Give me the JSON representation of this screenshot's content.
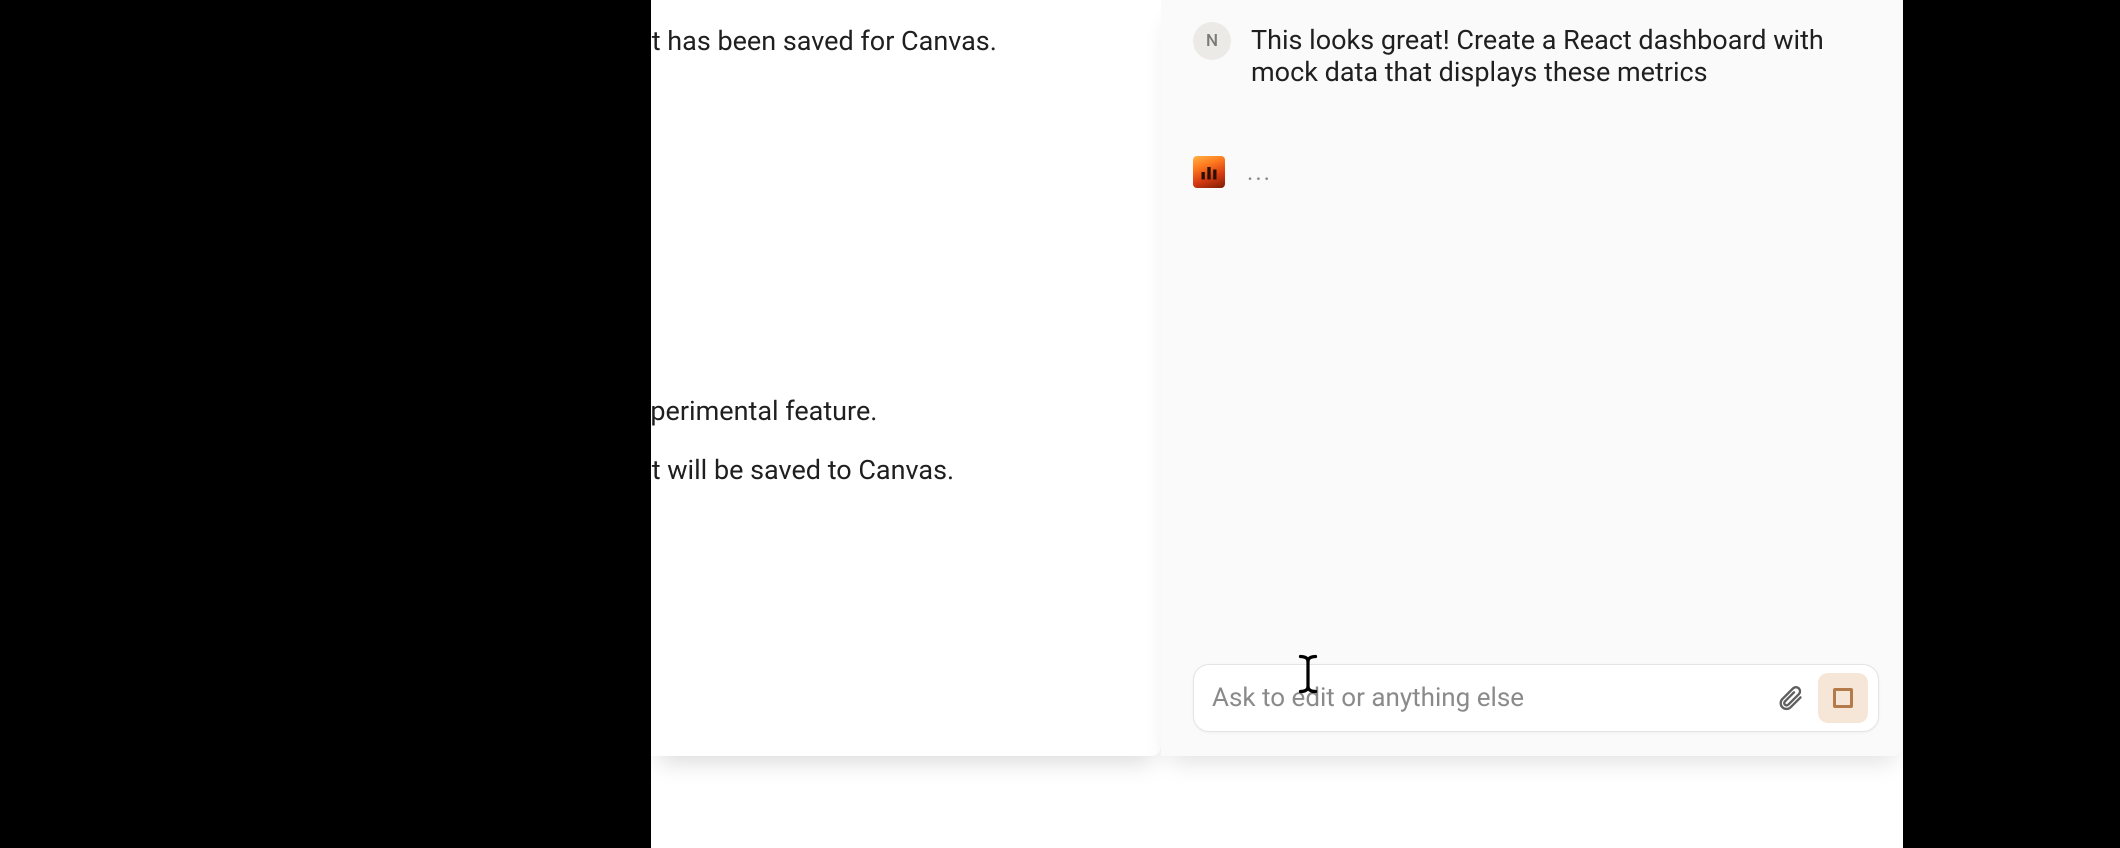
{
  "left_panel": {
    "line1": "This document has been saved for Canvas.",
    "line2": "This is an experimental feature.",
    "line3": "This document will be saved to Canvas."
  },
  "chat": {
    "user_initial": "N",
    "user_message": "This looks great! Create a React dashboard with mock data that displays these metrics",
    "typing_indicator": "..."
  },
  "input": {
    "placeholder": "Ask to edit or anything else"
  }
}
